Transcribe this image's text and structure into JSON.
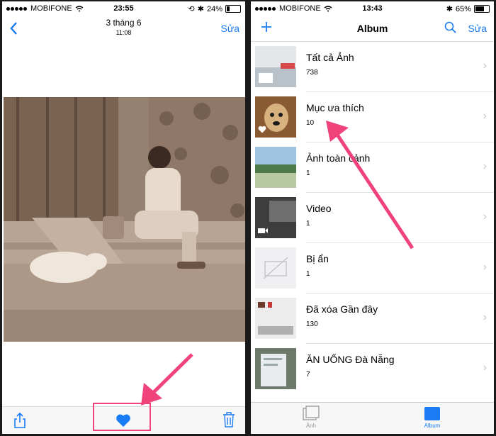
{
  "left": {
    "status": {
      "carrier": "MOBIFONE",
      "time": "23:55",
      "battery": "24%",
      "battery_level": 0.24
    },
    "nav": {
      "back_icon": "chevron-left-icon",
      "title": "3 tháng 6",
      "subtitle": "11:08",
      "edit": "Sửa"
    },
    "toolbar": {
      "share_icon": "share-icon",
      "favorite_icon": "heart-icon",
      "delete_icon": "trash-icon"
    }
  },
  "right": {
    "status": {
      "carrier": "MOBIFONE",
      "time": "13:43",
      "battery": "65%",
      "battery_level": 0.65
    },
    "nav": {
      "add_icon": "plus-icon",
      "title": "Album",
      "search_icon": "search-icon",
      "edit": "Sửa"
    },
    "albums": [
      {
        "name": "Tất cả Ảnh",
        "count": "738"
      },
      {
        "name": "Mục ưa thích",
        "count": "10"
      },
      {
        "name": "Ảnh toàn cảnh",
        "count": "1"
      },
      {
        "name": "Video",
        "count": "1"
      },
      {
        "name": "Bị ẩn",
        "count": "1"
      },
      {
        "name": "Đã xóa Gần đây",
        "count": "130"
      },
      {
        "name": "ĂN UỐNG Đà Nẵng",
        "count": "7"
      }
    ],
    "tabs": [
      {
        "label": "Ảnh"
      },
      {
        "label": "Album"
      }
    ]
  },
  "colors": {
    "accent": "#1a7cf5",
    "annotation": "#f0427b"
  }
}
